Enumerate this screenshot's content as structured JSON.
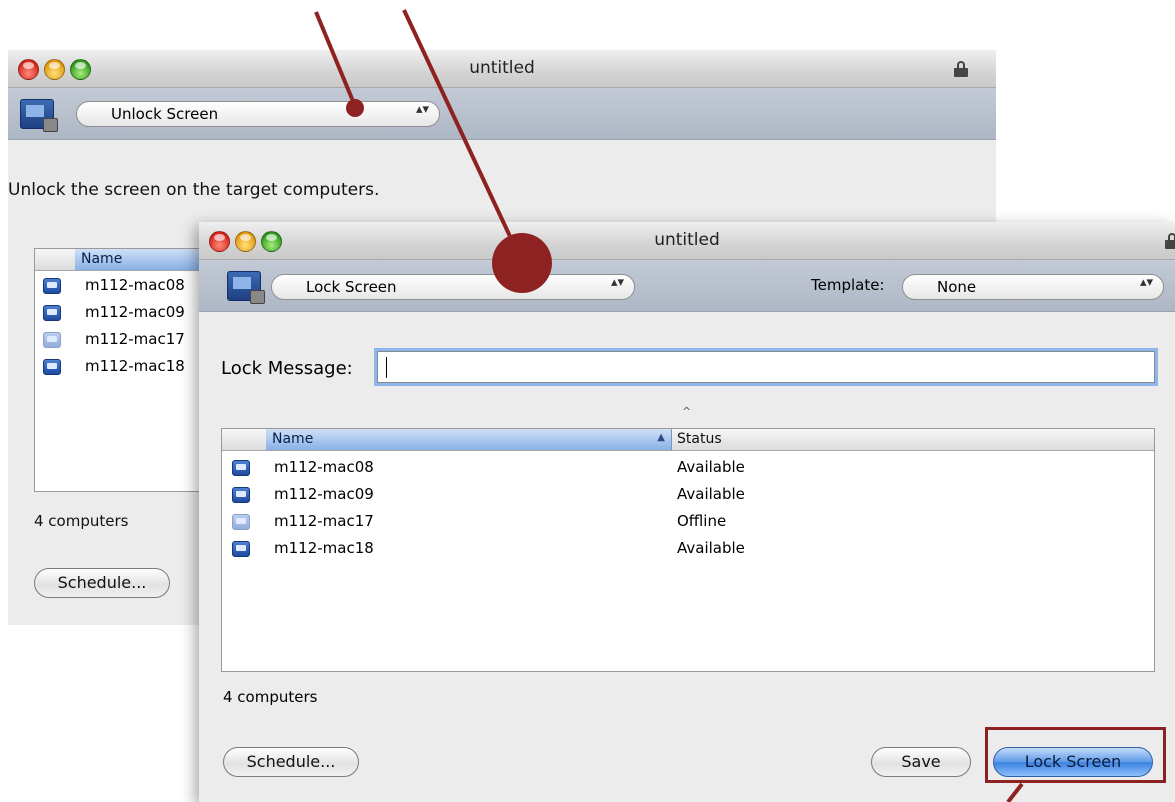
{
  "back_window": {
    "title": "untitled",
    "task_popup": "Unlock Screen",
    "description": "Unlock the screen on the target computers.",
    "list": {
      "column_name": "Name",
      "rows": [
        {
          "name": "m112-mac08",
          "dim": false
        },
        {
          "name": "m112-mac09",
          "dim": false
        },
        {
          "name": "m112-mac17",
          "dim": true
        },
        {
          "name": "m112-mac18",
          "dim": false
        }
      ]
    },
    "count": "4 computers",
    "schedule_button": "Schedule..."
  },
  "front_window": {
    "title": "untitled",
    "task_popup": "Lock Screen",
    "template_label": "Template:",
    "template_popup": "None",
    "lock_message_label": "Lock Message:",
    "lock_message_value": "",
    "sort_indicator": "^",
    "list": {
      "column_name": "Name",
      "column_status": "Status",
      "sort_arrow": "▲",
      "rows": [
        {
          "name": "m112-mac08",
          "status": "Available",
          "dim": false
        },
        {
          "name": "m112-mac09",
          "status": "Available",
          "dim": false
        },
        {
          "name": "m112-mac17",
          "status": "Offline",
          "dim": true
        },
        {
          "name": "m112-mac18",
          "status": "Available",
          "dim": false
        }
      ]
    },
    "count": "4 computers",
    "schedule_button": "Schedule...",
    "save_button": "Save",
    "lock_button": "Lock Screen"
  },
  "popup_arrows": "▴▾",
  "colors": {
    "annotation": "#8e2222",
    "primary_button": "#3b81e0",
    "toolbar": "#b4bccb"
  }
}
